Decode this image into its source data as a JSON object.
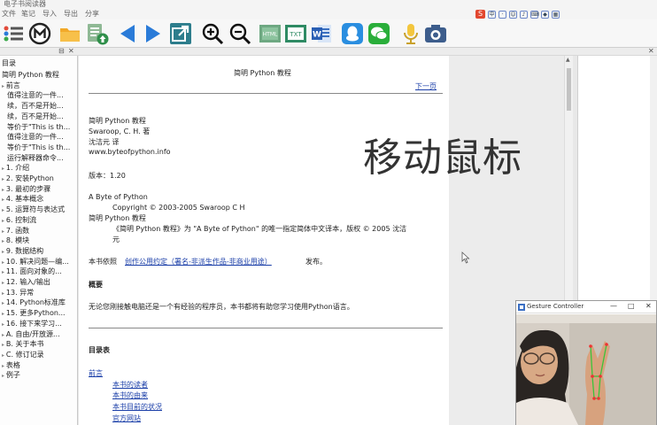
{
  "app": {
    "title": "电子书阅读器",
    "menu": [
      "文件",
      "笔记",
      "导入",
      "导出",
      "分享"
    ]
  },
  "toolbar": {
    "icons": [
      "list-icon",
      "m-logo-icon",
      "folder-icon",
      "upload-book-icon",
      "prev-arrow-icon",
      "next-arrow-icon",
      "share-icon",
      "zoom-in-icon",
      "zoom-out-icon",
      "html-export-icon",
      "txt-export-icon",
      "word-export-icon",
      "qq-icon",
      "wechat-icon",
      "microphone-icon",
      "camera-icon"
    ]
  },
  "toc": {
    "title": "目录",
    "items": [
      "简明 Python 教程",
      "前言",
      "值得注意的一件...",
      "续，百不是开始...",
      "续，百不是开始...",
      "等价于\"This is th...",
      "值得注意的一件...",
      "等价于\"This is th...",
      "运行解释器命令...",
      "1. 介绍",
      "2. 安装Python",
      "3. 最初的步骤",
      "4. 基本概念",
      "5. 运算符与表达式",
      "6. 控制流",
      "7. 函数",
      "8. 模块",
      "9. 数据结构",
      "10. 解决问题—编...",
      "11. 面向对象的...",
      "12. 输入/输出",
      "13. 异常",
      "14. Python标准库",
      "15. 更多Python...",
      "16. 接下来学习...",
      "A. 自由/开放源...",
      "B. 关于本书",
      "C. 修订记录",
      "表格",
      "例子"
    ]
  },
  "content": {
    "heading": "简明 Python 教程",
    "next_link": "下一页",
    "book_title": "简明 Python 教程",
    "author": "Swaroop, C. H. 著",
    "translator": "沈洁元  译",
    "website": "www.byteofpython.info",
    "version": "版本：1.20",
    "orig_title": "A Byte of Python",
    "copyright": "Copyright © 2003-2005 Swaroop C H",
    "cn_title": "简明 Python 教程",
    "desc_line1": "《简明 Python 教程》为 \"A Byte of Python\" 的唯一指定简体中文译本，版权 © 2005 沈洁",
    "desc_line2": "元",
    "license_prefix": "本书依照",
    "license_link": "创作公用约定（署名-非派生作品-非商业用途）",
    "license_suffix": "发布。",
    "summary_heading": "概要",
    "summary_text": "无论您刚接触电脑还是一个有经验的程序员，本书都将有助您学习使用Python语言。",
    "toc_heading": "目录表",
    "toc_links": [
      "前言",
      "本书的读者",
      "本书的由来",
      "本书目前的状况",
      "官方网站"
    ]
  },
  "overlay": {
    "text": "移动鼠标"
  },
  "gesture_window": {
    "title": "Gesture Controller",
    "buttons": [
      "—",
      "□",
      "✕"
    ]
  }
}
